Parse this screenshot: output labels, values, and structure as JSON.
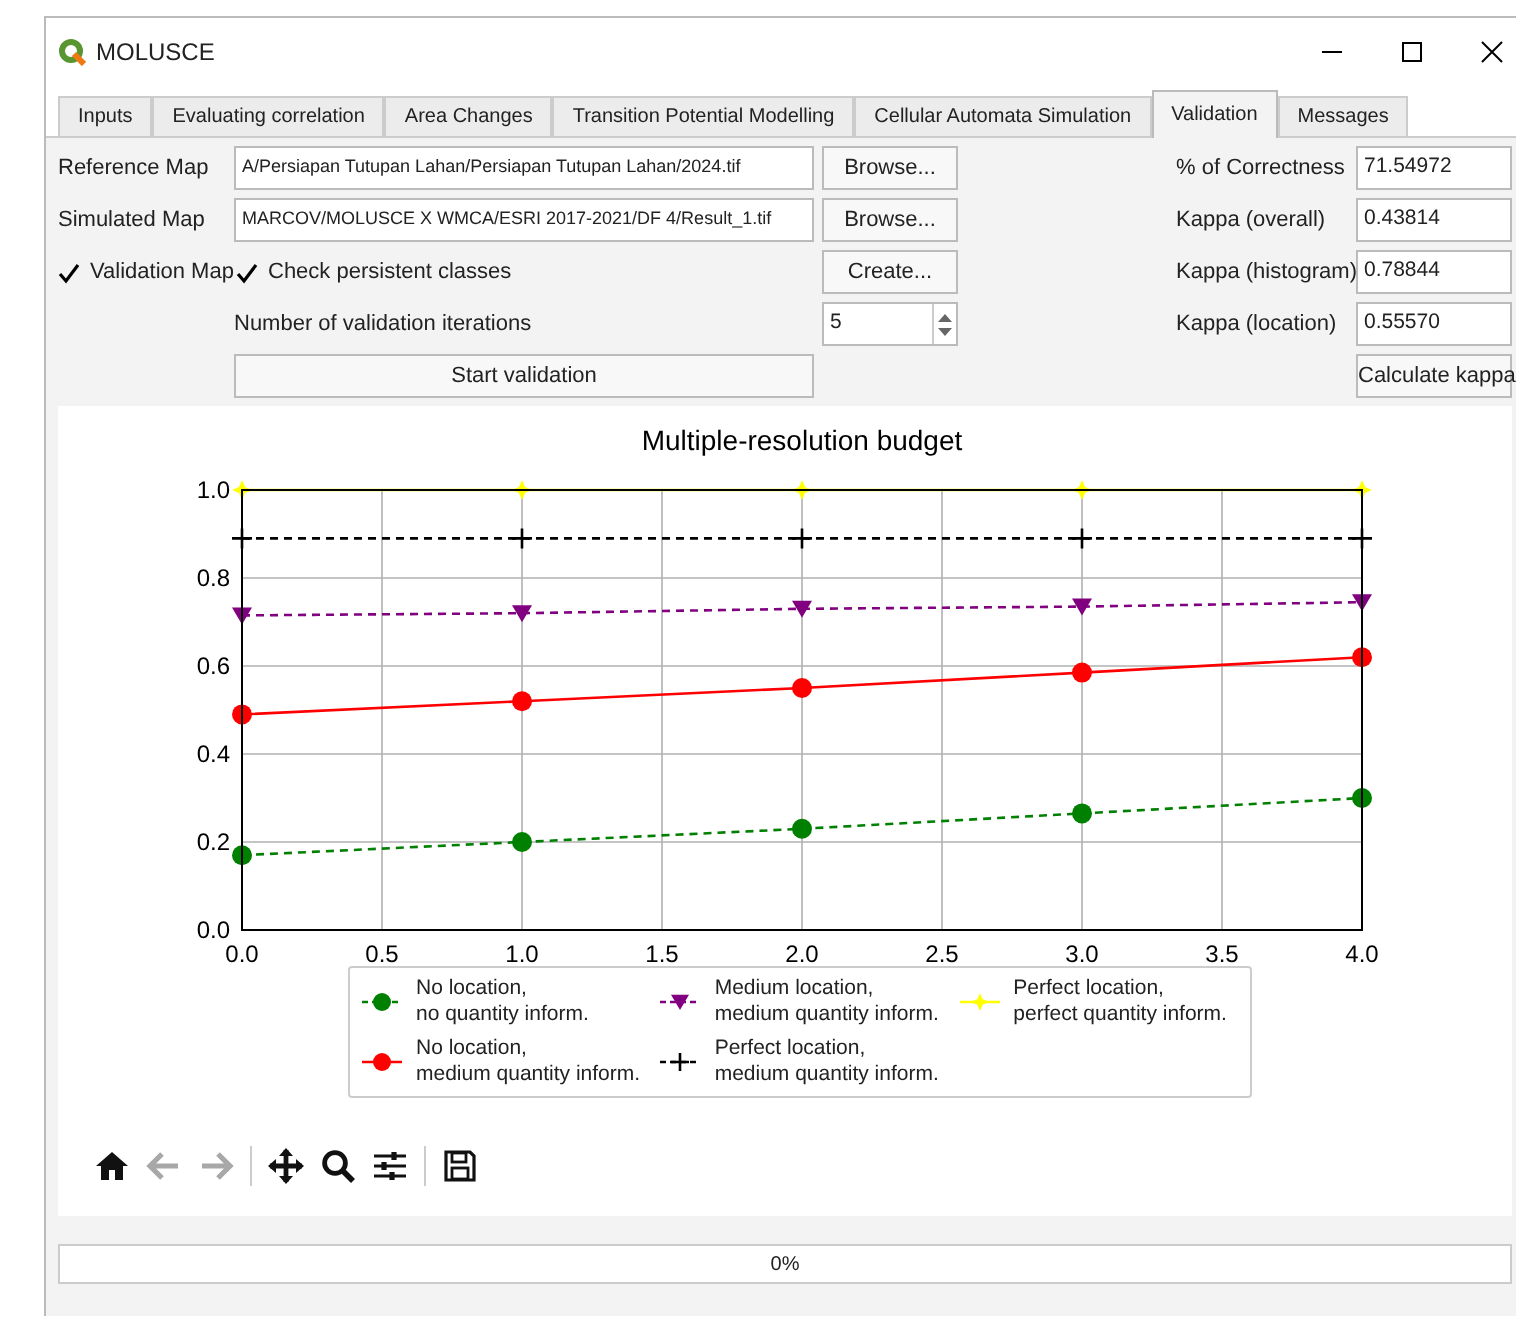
{
  "window": {
    "title": "MOLUSCE"
  },
  "tabs": [
    {
      "label": "Inputs",
      "selected": false
    },
    {
      "label": "Evaluating correlation",
      "selected": false
    },
    {
      "label": "Area Changes",
      "selected": false
    },
    {
      "label": "Transition Potential Modelling",
      "selected": false
    },
    {
      "label": "Cellular Automata Simulation",
      "selected": false
    },
    {
      "label": "Validation",
      "selected": true
    },
    {
      "label": "Messages",
      "selected": false
    }
  ],
  "reference_map": {
    "label": "Reference Map",
    "value": "A/Persiapan Tutupan Lahan/Persiapan Tutupan Lahan/2024.tif",
    "button": "Browse..."
  },
  "simulated_map": {
    "label": "Simulated Map",
    "value": "MARCOV/MOLUSCE X WMCA/ESRI 2017-2021/DF 4/Result_1.tif",
    "button": "Browse..."
  },
  "validation_map": {
    "label": "Validation Map",
    "checked": true
  },
  "check_persistent": {
    "label": "Check persistent classes",
    "checked": true
  },
  "create_button": "Create...",
  "iterations": {
    "label": "Number of validation iterations",
    "value": "5"
  },
  "start_button": "Start validation",
  "stats": [
    {
      "label": "% of Correctness",
      "value": "71.54972"
    },
    {
      "label": "Kappa (overall)",
      "value": "0.43814"
    },
    {
      "label": "Kappa (histogram)",
      "value": "0.78844"
    },
    {
      "label": "Kappa (location)",
      "value": "0.55570"
    }
  ],
  "calculate_button": "Calculate kappa",
  "chart_data": {
    "type": "line",
    "title": "Multiple-resolution budget",
    "grid": true,
    "legend": true,
    "x": [
      0,
      1,
      2,
      3,
      4
    ],
    "xlim": [
      0,
      4
    ],
    "ylim": [
      0,
      1
    ],
    "xticks": [
      {
        "value": 0,
        "label": "0.0"
      },
      {
        "value": 0.5,
        "label": "0.5"
      },
      {
        "value": 1,
        "label": "1.0"
      },
      {
        "value": 1.5,
        "label": "1.5"
      },
      {
        "value": 2,
        "label": "2.0"
      },
      {
        "value": 2.5,
        "label": "2.5"
      },
      {
        "value": 3,
        "label": "3.0"
      },
      {
        "value": 3.5,
        "label": "3.5"
      },
      {
        "value": 4,
        "label": "4.0"
      }
    ],
    "yticks": [
      {
        "value": 0,
        "label": "0.0"
      },
      {
        "value": 0.2,
        "label": "0.2"
      },
      {
        "value": 0.4,
        "label": "0.4"
      },
      {
        "value": 0.6,
        "label": "0.6"
      },
      {
        "value": 0.8,
        "label": "0.8"
      },
      {
        "value": 1,
        "label": "1.0"
      }
    ],
    "series": [
      {
        "name": "No location,\nno quantity inform.",
        "color": "#008000",
        "marker": "circle",
        "line_style": "dashed",
        "values": [
          0.17,
          0.2,
          0.23,
          0.265,
          0.3
        ]
      },
      {
        "name": "No location,\nmedium quantity inform.",
        "color": "#ff0000",
        "marker": "circle",
        "line_style": "solid",
        "values": [
          0.49,
          0.52,
          0.55,
          0.585,
          0.62
        ]
      },
      {
        "name": "Medium location,\nmedium quantity inform.",
        "color": "#800080",
        "marker": "triangle",
        "line_style": "dashed",
        "values": [
          0.715,
          0.72,
          0.73,
          0.735,
          0.745
        ]
      },
      {
        "name": "Perfect location,\nmedium quantity inform.",
        "color": "#000000",
        "marker": "plus",
        "line_style": "dashed",
        "values": [
          0.89,
          0.89,
          0.89,
          0.89,
          0.89
        ]
      },
      {
        "name": "Perfect location,\nperfect quantity inform.",
        "color": "#ffff00",
        "marker": "star",
        "line_style": "solid",
        "values": [
          1,
          1,
          1,
          1,
          1
        ]
      }
    ]
  },
  "toolbar": [
    {
      "kind": "home",
      "disabled": false
    },
    {
      "kind": "back",
      "disabled": true
    },
    {
      "kind": "forward",
      "disabled": true
    },
    {
      "kind": "pan",
      "disabled": false
    },
    {
      "kind": "zoom",
      "disabled": false
    },
    {
      "kind": "configure",
      "disabled": false
    },
    {
      "kind": "save",
      "disabled": false
    }
  ],
  "progress": {
    "level": 0,
    "text": "0%"
  }
}
